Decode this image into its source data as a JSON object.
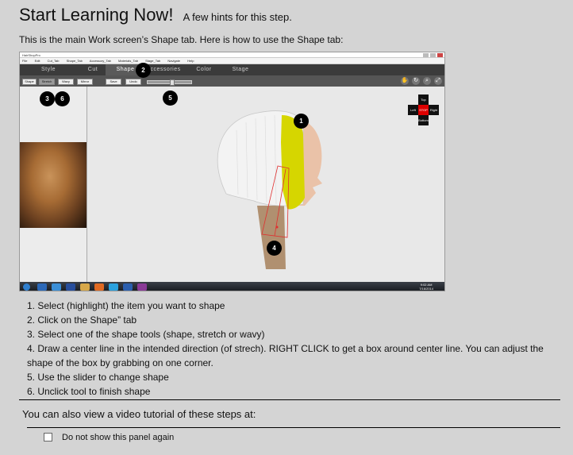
{
  "header": {
    "title": "Start Learning Now!",
    "subtitle": "A few hints for this step.",
    "intro": "This is the main Work screen’s Shape tab. Here is how to use the Shape tab:"
  },
  "screenshot": {
    "window_title": "HairShopPro",
    "menu": [
      "File",
      "Edit",
      "Cut_Tab",
      "Shape_Tab",
      "Accessory_Tab",
      "Materials_Tab",
      "Stage_Tab",
      "Navigate",
      "Help"
    ],
    "tabs": [
      "Style",
      "Cut",
      "Shape",
      "Accessories",
      "Color",
      "Stage"
    ],
    "active_tab": "Shape",
    "tools": [
      "Shape",
      "Stretch",
      "Wavy",
      "Mirror",
      "Save",
      "Undo"
    ],
    "nav": {
      "top": "Top",
      "left": "Left",
      "stop": "STOP",
      "right": "Right",
      "bottom": "Bottom"
    },
    "clock": {
      "time": "9:02 AM",
      "date": "7/16/2014"
    },
    "callouts": [
      "1",
      "2",
      "3",
      "4",
      "5",
      "6"
    ],
    "colors": {
      "tabbar": "#3b3b3b",
      "hair_white": "#f2f2f2",
      "hair_yellow": "#d6d600",
      "stop": "#dd0000"
    }
  },
  "steps": [
    "1. Select (highlight) the item you want to shape",
    "2. Click on the Shape” tab",
    "3. Select one of the shape tools (shape, stretch or wavy)",
    "4. Draw a center line in the intended direction (of strech). RIGHT CLICK to get a box around center line. You can adjust the shape of the box by grabbing on one corner.",
    "5. Use the slider to change shape",
    "6. Unclick tool to finish shape"
  ],
  "footer": {
    "video_text": "You can also view a video tutorial of these steps at:",
    "checkbox_label": "Do not show this panel again",
    "checkbox_checked": false
  }
}
